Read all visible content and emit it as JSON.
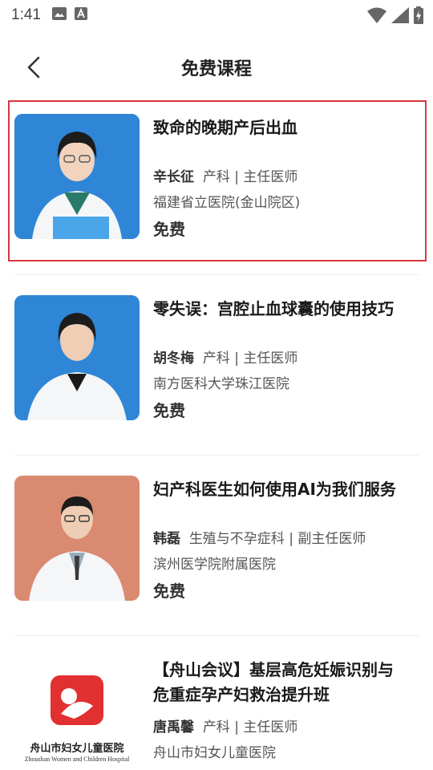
{
  "status_bar": {
    "time": "1:41"
  },
  "header": {
    "title": "免费课程"
  },
  "courses": [
    {
      "title": "致命的晚期产后出血",
      "doctor": "辛长征",
      "role": "产科 | 主任医师",
      "hospital": "福建省立医院(金山院区)",
      "price": "免费"
    },
    {
      "title": "零失误：宫腔止血球囊的使用技巧",
      "doctor": "胡冬梅",
      "role": "产科 | 主任医师",
      "hospital": "南方医科大学珠江医院",
      "price": "免费"
    },
    {
      "title": "妇产科医生如何使用AI为我们服务",
      "doctor": "韩磊",
      "role": "生殖与不孕症科 | 副主任医师",
      "hospital": "滨州医学院附属医院",
      "price": "免费"
    },
    {
      "title_line1": "【舟山会议】基层高危妊娠识别与",
      "title_line2": "危重症孕产妇救治提升班",
      "doctor": "唐禹馨",
      "role": "产科 | 主任医师",
      "hospital": "舟山市妇女儿童医院",
      "logo_text_cn": "舟山市妇女儿童医院",
      "logo_text_en": "Zhoushan Women and Children Hospital"
    }
  ],
  "colors": {
    "highlight": "#d9363e",
    "blue_bg": "#2f86d6",
    "orange_bg": "#d98a70",
    "logo_red": "#e03030"
  }
}
